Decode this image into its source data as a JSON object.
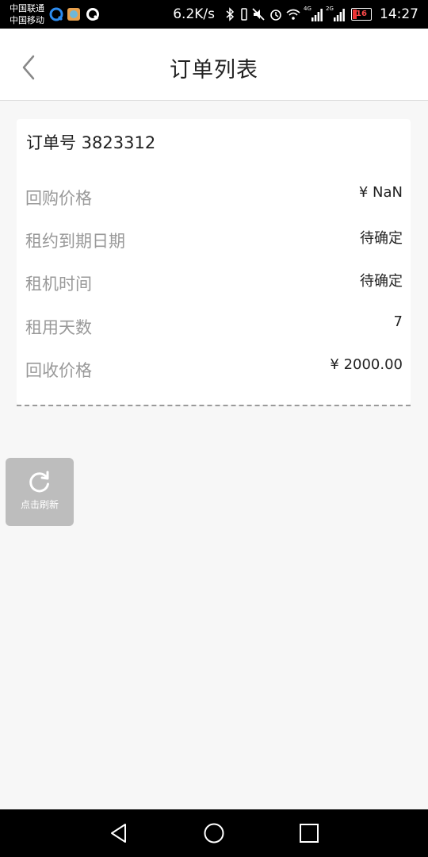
{
  "status_bar": {
    "carrier1": "中国联通",
    "carrier2": "中国移动",
    "speed": "6.2K/s",
    "battery": "16",
    "time": "14:27",
    "net_tag_1": "4G",
    "net_tag_2": "2G"
  },
  "header": {
    "title": "订单列表",
    "back_icon": "chevron-left-icon"
  },
  "order": {
    "number_label": "订单号 3823312",
    "rows": [
      {
        "label": "回购价格",
        "value": "¥ NaN"
      },
      {
        "label": "租约到期日期",
        "value": "待确定"
      },
      {
        "label": "租机时间",
        "value": "待确定"
      },
      {
        "label": "租用天数",
        "value": "7"
      },
      {
        "label": "回收价格",
        "value": "¥ 2000.00"
      }
    ]
  },
  "refresh": {
    "label": "点击刷新",
    "icon": "refresh-icon"
  },
  "colors": {
    "background": "#f7f7f7",
    "label_gray": "#999999",
    "refresh_bg": "#bdbdbd",
    "battery_red": "#ff4a4a"
  }
}
